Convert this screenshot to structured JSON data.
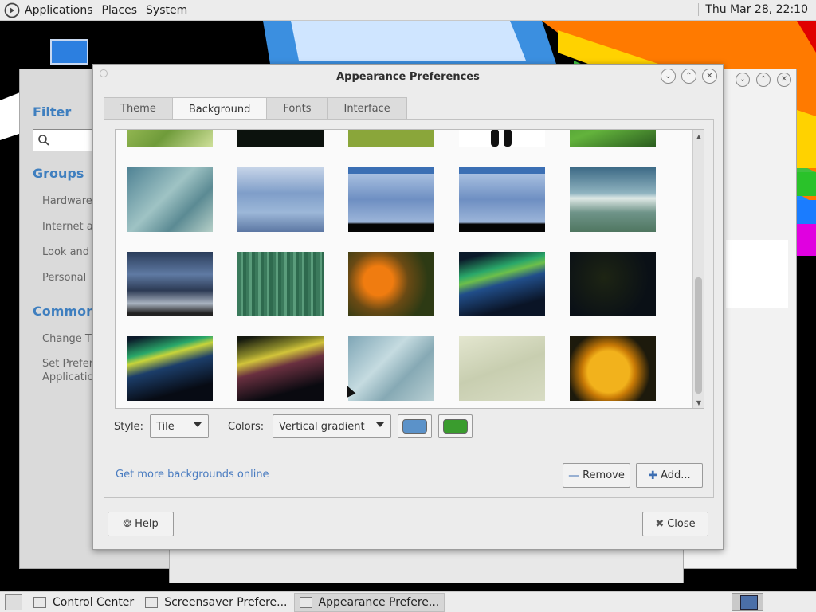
{
  "top_panel": {
    "menus": [
      "Applications",
      "Places",
      "System"
    ],
    "clock": "Thu Mar 28, 22:10"
  },
  "control_center": {
    "filter_heading": "Filter",
    "groups_heading": "Groups",
    "groups": [
      "Hardware",
      "Internet ar",
      "Look and F",
      "Personal"
    ],
    "common_heading": "Common T",
    "common_items": [
      "Change Th",
      "Set Preferr",
      "Applicatio"
    ]
  },
  "dialog": {
    "title": "Appearance Preferences",
    "tabs": [
      {
        "label": "Theme",
        "active": false
      },
      {
        "label": "Background",
        "active": true
      },
      {
        "label": "Fonts",
        "active": false
      },
      {
        "label": "Interface",
        "active": false
      }
    ],
    "style_label": "Style:",
    "style_value": "Tile",
    "colors_label": "Colors:",
    "colors_value": "Vertical gradient",
    "color_primary": "#5b92c9",
    "color_secondary": "#3a9c2e",
    "get_more_link": "Get more backgrounds online",
    "remove_label": "Remove",
    "add_label": "Add...",
    "help_label": "Help",
    "close_label": "Close"
  },
  "taskbar": {
    "tasks": [
      {
        "label": "Control Center",
        "active": false
      },
      {
        "label": "Screensaver Prefere...",
        "active": false
      },
      {
        "label": "Appearance Prefere...",
        "active": true
      }
    ]
  }
}
